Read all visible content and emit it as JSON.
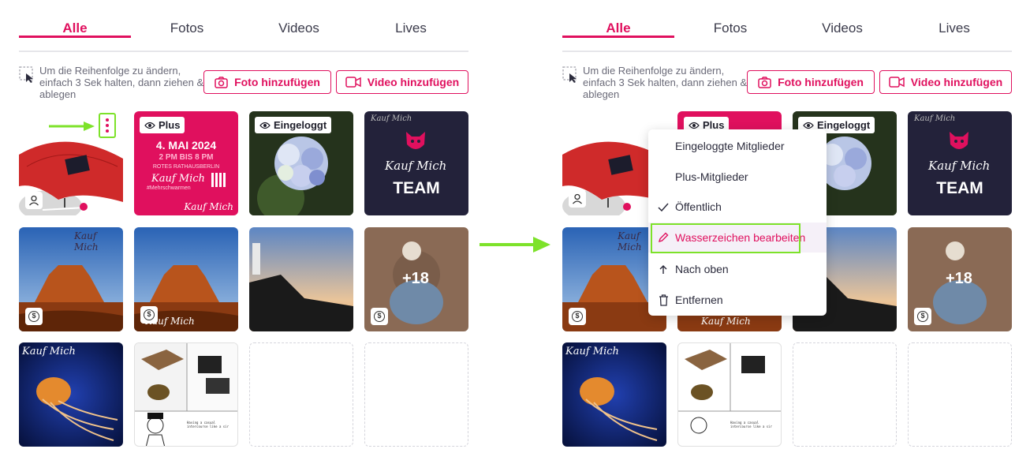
{
  "colors": {
    "accent": "#e0105e",
    "highlight_green": "#7de22a",
    "dark_tile": "#23223a"
  },
  "tabs": [
    {
      "label": "Alle",
      "active": true
    },
    {
      "label": "Fotos",
      "active": false
    },
    {
      "label": "Videos",
      "active": false
    },
    {
      "label": "Lives",
      "active": false
    }
  ],
  "reorder_hint": "Um die Reihenfolge zu ändern, einfach 3 Sek halten, dann ziehen & ablegen",
  "buttons": {
    "add_photo": "Foto hinzufügen",
    "add_video": "Video hinzufügen"
  },
  "badges": {
    "plus": "Plus",
    "logged_in": "Eingeloggt",
    "adult": "+18",
    "coin": "$"
  },
  "event_tile": {
    "date": "4. MAI 2024",
    "time": "2 PM BIS 8 PM",
    "venue": "ROTES RATHAUSBERLIN",
    "hashtag": "#Mehrschwarmen"
  },
  "brand": {
    "watermark": "Kauf Mich",
    "team": "TEAM"
  },
  "context_menu": {
    "items": [
      {
        "label": "Eingeloggte Mitglieder",
        "icon": ""
      },
      {
        "label": "Plus-Mitglieder",
        "icon": ""
      },
      {
        "label": "Öffentlich",
        "icon": "check-icon"
      },
      {
        "label": "Wasserzeichen bearbeiten",
        "icon": "pencil-icon"
      },
      {
        "label": "Nach oben",
        "icon": "arrow-up-icon"
      },
      {
        "label": "Entfernen",
        "icon": "trash-icon"
      }
    ]
  },
  "meme_text": "Having a casual intercourse like a sir"
}
